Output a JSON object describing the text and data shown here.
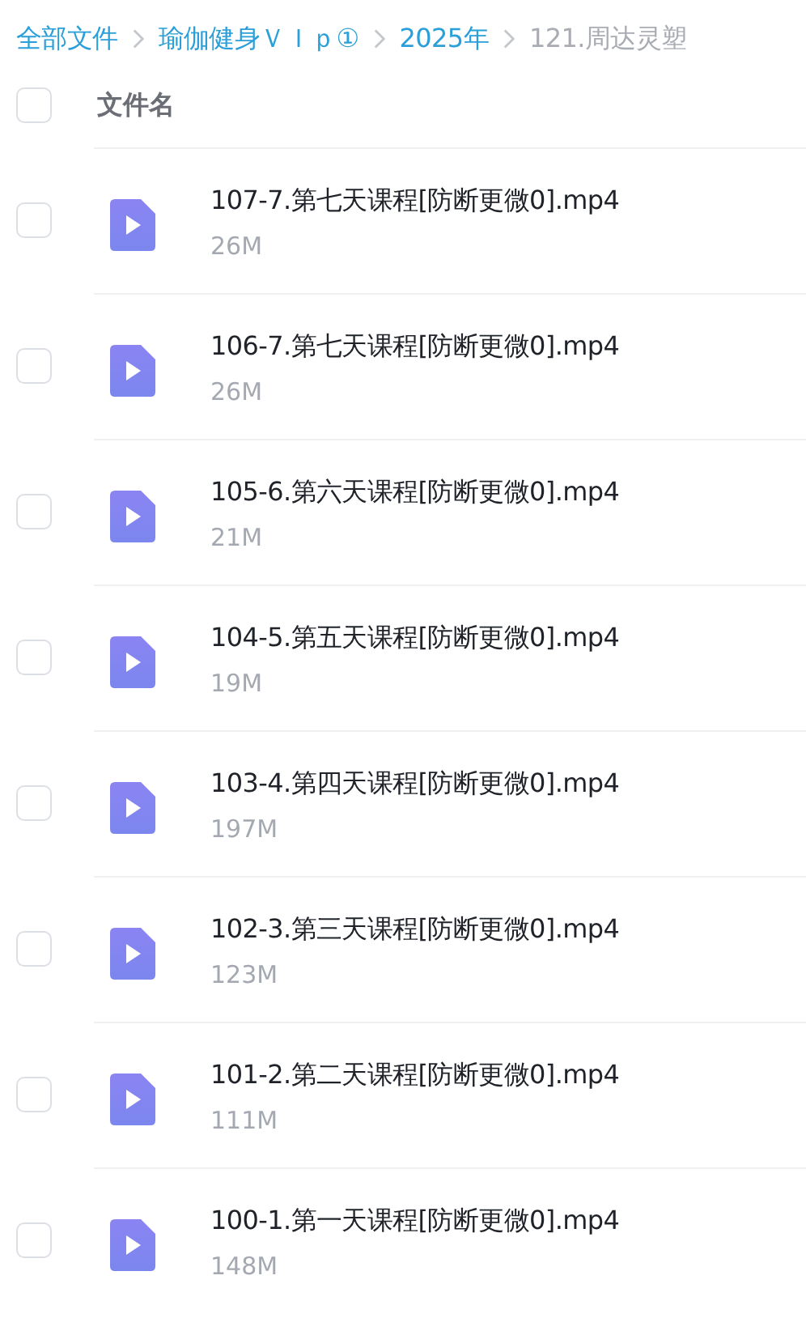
{
  "breadcrumb": [
    {
      "label": "全部文件",
      "current": false
    },
    {
      "label": "瑜伽健身ＶＩｐ①",
      "current": false
    },
    {
      "label": "2025年",
      "current": false
    },
    {
      "label": "121.周达灵塑",
      "current": true
    }
  ],
  "header": {
    "checked": false,
    "label": "文件名"
  },
  "files": [
    {
      "name": "107-7.第七天课程[防断更微0].mp4",
      "size": "26M",
      "checked": false,
      "kind": "video"
    },
    {
      "name": "106-7.第七天课程[防断更微0].mp4",
      "size": "26M",
      "checked": false,
      "kind": "video"
    },
    {
      "name": "105-6.第六天课程[防断更微0].mp4",
      "size": "21M",
      "checked": false,
      "kind": "video"
    },
    {
      "name": "104-5.第五天课程[防断更微0].mp4",
      "size": "19M",
      "checked": false,
      "kind": "video"
    },
    {
      "name": "103-4.第四天课程[防断更微0].mp4",
      "size": "197M",
      "checked": false,
      "kind": "video"
    },
    {
      "name": "102-3.第三天课程[防断更微0].mp4",
      "size": "123M",
      "checked": false,
      "kind": "video"
    },
    {
      "name": "101-2.第二天课程[防断更微0].mp4",
      "size": "111M",
      "checked": false,
      "kind": "video"
    },
    {
      "name": "100-1.第一天课程[防断更微0].mp4",
      "size": "148M",
      "checked": false,
      "kind": "video"
    }
  ]
}
